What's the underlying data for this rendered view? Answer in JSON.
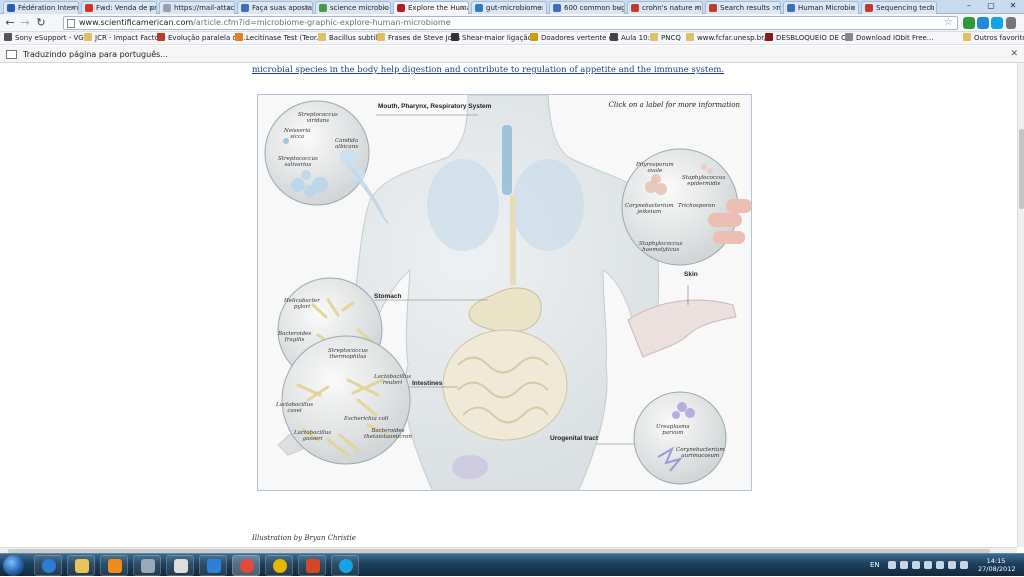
{
  "browser": {
    "tabs": [
      {
        "label": "Fédération Interna",
        "color": "#2a5db0"
      },
      {
        "label": "Fwd: Venda de pr",
        "color": "#d93025"
      },
      {
        "label": "https://mail-attac",
        "color": "#9aa0a6"
      },
      {
        "label": "Faça suas apostas",
        "color": "#3b6fb6"
      },
      {
        "label": "science microbio",
        "color": "#4a9a4a"
      },
      {
        "label": "Explore the Huma",
        "color": "#b71c1c"
      },
      {
        "label": "gut-microbiome",
        "color": "#2e7fbf"
      },
      {
        "label": "600 common bug",
        "color": "#3b6fb6"
      },
      {
        "label": "crohn's nature m",
        "color": "#c0392b"
      },
      {
        "label": "Search results : m",
        "color": "#c0392b"
      },
      {
        "label": "Human Microbio",
        "color": "#3b6fb6"
      },
      {
        "label": "Sequencing tech",
        "color": "#c0392b"
      }
    ],
    "active_tab": "Explore the Huma",
    "url_domain": "www.scientificamerican.com",
    "url_path": "/article.cfm?id=microbiome-graphic-explore-human-microbiome",
    "bookmarks": [
      {
        "label": "Sony eSupport - VG",
        "color": "#555"
      },
      {
        "label": "JCR - Impact Factor",
        "color": "#e0c060"
      },
      {
        "label": "Evolução paralela de...",
        "color": "#c0392b"
      },
      {
        "label": "Lecitinase Test (Teor...",
        "color": "#e67e22"
      },
      {
        "label": "Bacillus subtilis",
        "color": "#e0c060"
      },
      {
        "label": "Frases de Steve Jobs",
        "color": "#e0c060"
      },
      {
        "label": "Shear-maior ligação...",
        "color": "#333"
      },
      {
        "label": "Doadores vertente c...",
        "color": "#c8a000"
      },
      {
        "label": "Aula 10:",
        "color": "#444"
      },
      {
        "label": "PNCQ",
        "color": "#e0c060"
      },
      {
        "label": "www.fcfar.unesp.br/...",
        "color": "#e0c060"
      },
      {
        "label": "DESBLOQUEIO DE C...",
        "color": "#8b1a1a"
      },
      {
        "label": "Download IObit Free...",
        "color": "#888"
      },
      {
        "label": "Outros favoritos",
        "color": "#e0c060"
      }
    ]
  },
  "translate_bar": {
    "message": "Traduzindo página para português..."
  },
  "article": {
    "intro_text": "microbial species in the body help digestion and contribute to regulation of appetite and the immune system.",
    "credit": "Illustration by Bryan Christie"
  },
  "figure": {
    "hint": "Click on a label for more information",
    "regions": {
      "mouth": "Mouth, Pharynx, Respiratory System",
      "skin": "Skin",
      "stomach": "Stomach",
      "intestines": "Intestines",
      "urogenital": "Urogenital tract"
    },
    "microbes": {
      "strep_viridans": "Streptococcus\nviridans",
      "neisseria": "Neisseria\nsicca",
      "candida": "Candida\nalbicans",
      "strep_salivarius": "Streptococcus\nsalivarius",
      "pityrosporum": "Pityrosporum\novale",
      "staph_epidermidis": "Staphylococcus\nepidermidis",
      "corynebacterium_jeikeium": "Corynebacterium\njeikeium",
      "trichosporon": "Trichosporon",
      "staph_haemolyticus": "Staphylococcus\nhaemolyticus",
      "helicobacter": "Helicobacter\npylori",
      "bacteroides_fragilis": "Bacteroides\nfragilis",
      "strep_thermophilus": "Streptococcus\nthermophilus",
      "lactobacillus_reuteri": "Lactobacillus\nreuteri",
      "lactobacillus_casei": "Lactobacillus\ncasei",
      "escherichia": "Escherichia coli",
      "lactobacillus_gasseri": "Lactobacillus\ngasseri",
      "bacteroides_theta": "Bacteroides\nthetaiotaomicron",
      "ureaplasma": "Ureaplasma\nparvum",
      "corynebacterium_auri": "Corynebacterium\naurimucosum"
    }
  },
  "taskbar": {
    "language": "EN",
    "time": "14:15",
    "date": "27/08/2012",
    "apps": [
      {
        "name": "ie",
        "color": "#2a7fd4"
      },
      {
        "name": "explorer",
        "color": "#e8c25a"
      },
      {
        "name": "media",
        "color": "#f08c1c"
      },
      {
        "name": "app4",
        "color": "#9ab"
      },
      {
        "name": "app5",
        "color": "#ddd"
      },
      {
        "name": "dropbox",
        "color": "#2f7fd8"
      },
      {
        "name": "chrome",
        "color": "#e04b3b"
      },
      {
        "name": "app8",
        "color": "#e6b800"
      },
      {
        "name": "powerpoint",
        "color": "#d24726"
      },
      {
        "name": "skype",
        "color": "#12a5e6"
      }
    ]
  }
}
